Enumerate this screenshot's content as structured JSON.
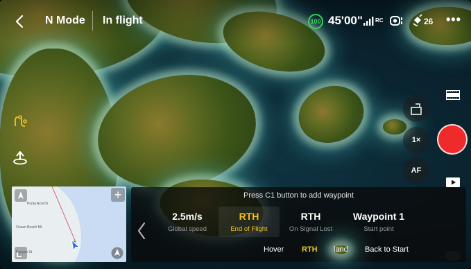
{
  "topbar": {
    "flight_mode": "N Mode",
    "flight_state": "In flight",
    "battery_percent": "100",
    "flight_time": "45'00\"",
    "rc_label": "RC",
    "satellite_count": "26",
    "more_label": "•••"
  },
  "camera": {
    "zoom_label": "1×",
    "af_label": "AF",
    "shutter_color": "#ee2a2a"
  },
  "minimap": {
    "labels": [
      "Punta Azul Dr",
      "Ocean Beach Mt",
      "Kanyon St"
    ],
    "add_label": "+"
  },
  "waypoint_panel": {
    "hint": "Press C1 button to add waypoint",
    "options": [
      {
        "value": "2.5m/s",
        "label": "Global speed"
      },
      {
        "value": "RTH",
        "label": "End of Flight"
      },
      {
        "value": "RTH",
        "label": "On Signal Lost"
      },
      {
        "value": "Waypoint 1",
        "label": "Start point"
      }
    ],
    "actions": [
      "Hover",
      "RTH",
      "land",
      "Back to Start"
    ],
    "selected_option_index": 1,
    "selected_action_index": 1,
    "highlight_color": "#f6c21a"
  },
  "icons": {
    "back": "chevron-left-icon",
    "battery": "battery-ring-icon",
    "signal": "signal-bars-icon",
    "camera": "gimbal-camera-icon",
    "satellite": "satellite-icon",
    "route": "route-icon",
    "rth": "return-home-icon",
    "rotate": "rotate-lens-icon",
    "filmstrip": "filmstrip-icon",
    "playback": "playback-icon",
    "north": "north-arrow-icon",
    "expand": "expand-icon",
    "compass": "compass-icon",
    "aircraft": "aircraft-icon",
    "collapse": "chevron-left-icon"
  }
}
